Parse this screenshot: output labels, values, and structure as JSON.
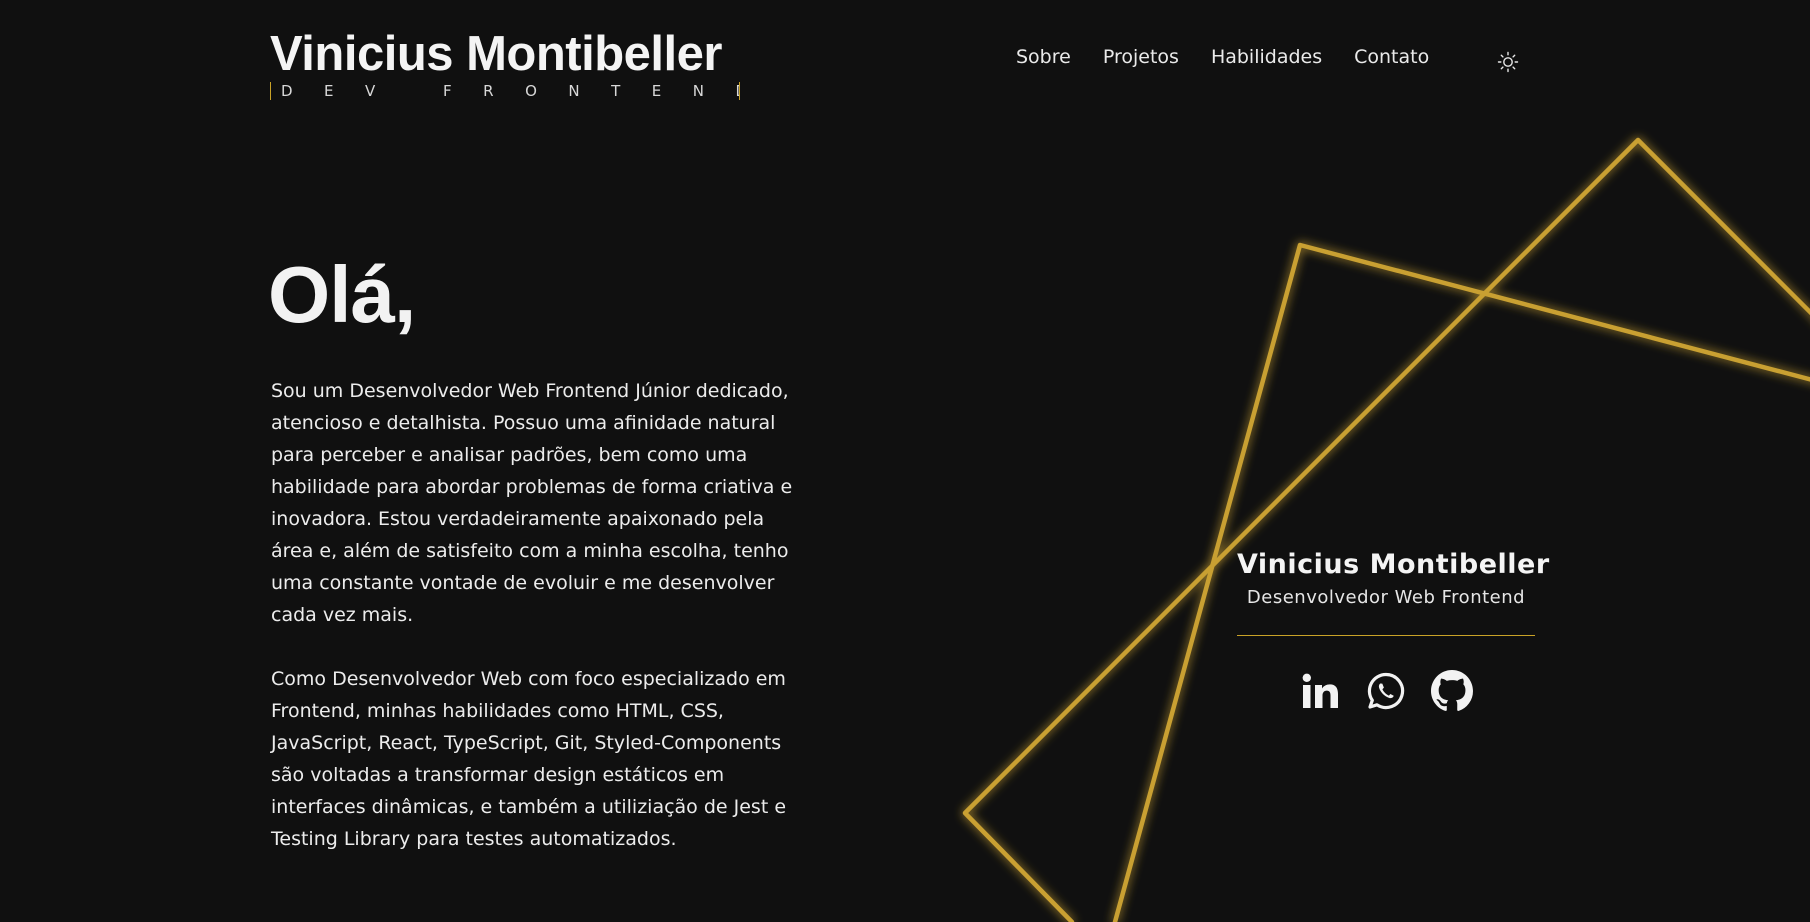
{
  "header": {
    "brand_name": "Vinicius Montibeller",
    "brand_subtitle": "DEV FRONTEND",
    "nav": [
      {
        "label": "Sobre"
      },
      {
        "label": "Projetos"
      },
      {
        "label": "Habilidades"
      },
      {
        "label": "Contato"
      }
    ],
    "theme_toggle_icon": "sun-icon"
  },
  "hero": {
    "greeting": "Olá,",
    "paragraphs": [
      "Sou um Desenvolvedor Web Frontend Júnior dedicado, atencioso e detalhista. Possuo uma afinidade natural para perceber e analisar padrões, bem como uma habilidade para abordar problemas de forma criativa e inovadora. Estou verdadeiramente apaixonado pela área e, além de satisfeito com a minha escolha, tenho uma constante vontade de evoluir e me desenvolver cada vez mais.",
      "Como Desenvolvedor Web com foco especializado em Frontend, minhas habilidades como HTML, CSS, JavaScript, React, TypeScript, Git, Styled-Components são voltadas a transformar design estáticos em interfaces dinâmicas, e também a utiliziação de Jest e Testing Library para testes automatizados."
    ]
  },
  "card": {
    "name": "Vinicius Montibeller",
    "role": "Desenvolvedor Web Frontend",
    "socials": [
      {
        "icon": "linkedin-icon"
      },
      {
        "icon": "whatsapp-icon"
      },
      {
        "icon": "github-icon"
      }
    ]
  },
  "colors": {
    "background": "#101010",
    "accent": "#c9a227",
    "text": "#f2f2f2"
  }
}
